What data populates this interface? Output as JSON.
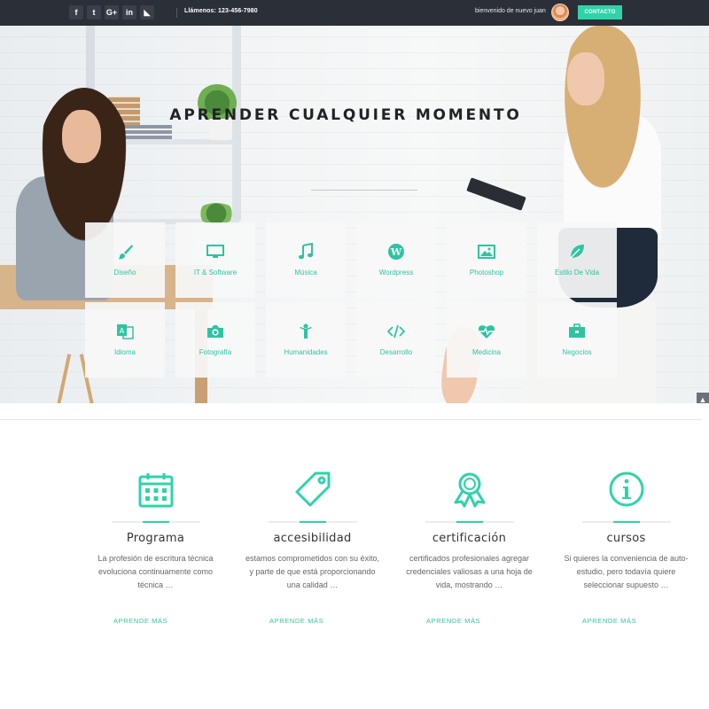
{
  "topbar": {
    "social": [
      {
        "icon": "facebook-icon",
        "glyph": "f"
      },
      {
        "icon": "twitter-icon",
        "glyph": "t"
      },
      {
        "icon": "google-plus-icon",
        "glyph": "G+"
      },
      {
        "icon": "linkedin-icon",
        "glyph": "in"
      },
      {
        "icon": "rss-icon",
        "glyph": "◣"
      }
    ],
    "phone": "Llámenos: 123-456-7980",
    "welcome": "bienvenido de nuevo juan",
    "contact_label": "CONTACTO"
  },
  "hero": {
    "title": "APRENDER CUALQUIER MOMENTO",
    "categories": [
      {
        "label": "Diseño",
        "icon": "paintbrush-icon"
      },
      {
        "label": "IT & Software",
        "icon": "monitor-icon"
      },
      {
        "label": "Música",
        "icon": "music-note-icon"
      },
      {
        "label": "Wordpress",
        "icon": "wordpress-icon"
      },
      {
        "label": "Photoshop",
        "icon": "image-icon"
      },
      {
        "label": "Estilo De Vida",
        "icon": "leaf-icon"
      },
      {
        "label": "Idioma",
        "icon": "translate-icon"
      },
      {
        "label": "Fotografía",
        "icon": "camera-icon"
      },
      {
        "label": "Humanidades",
        "icon": "person-icon"
      },
      {
        "label": "Desarrollo",
        "icon": "code-icon"
      },
      {
        "label": "Medicina",
        "icon": "heartbeat-icon"
      },
      {
        "label": "Negocios",
        "icon": "briefcase-icon"
      }
    ]
  },
  "features": [
    {
      "title": "Programa",
      "icon": "calendar-icon",
      "text": "La profesión de escritura técnica evoluciona continuamente como técnica …",
      "link": "APRENDE MÁS"
    },
    {
      "title": "accesibilidad",
      "icon": "tag-icon",
      "text": "estamos comprometidos con su éxito, y parte de que está proporcionando una calidad …",
      "link": "APRENDE MÁS"
    },
    {
      "title": "certificación",
      "icon": "award-icon",
      "text": "certificados profesionales agregar credenciales valiosas a una hoja de vida, mostrando …",
      "link": "APRENDE MÁS"
    },
    {
      "title": "cursos",
      "icon": "info-icon",
      "text": "Si quieres la conveniencia de auto-estudio, pero todavía quiere seleccionar supuesto …",
      "link": "APRENDE MÁS"
    }
  ],
  "colors": {
    "accent": "#2fd3a8",
    "topbar": "#2b2f38"
  }
}
